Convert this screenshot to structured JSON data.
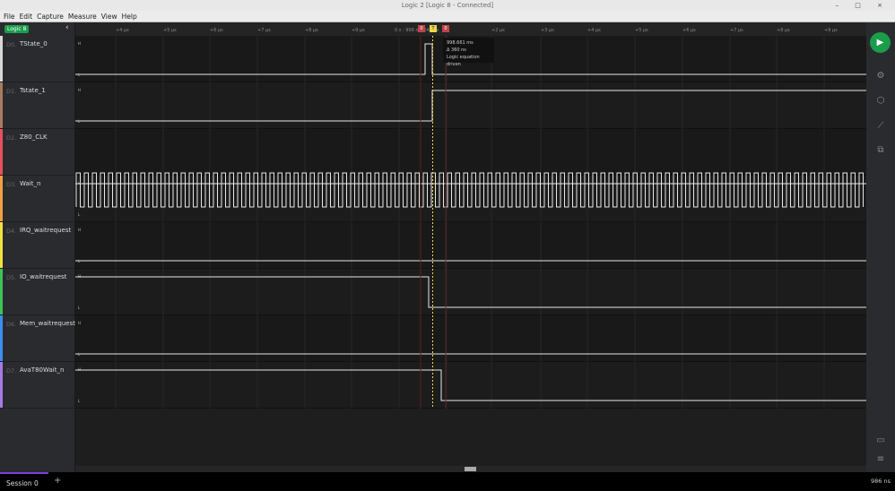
{
  "window": {
    "title": "Logic 2 [Logic 8 - Connected]",
    "controls": "– □ ×"
  },
  "menu": [
    "File",
    "Edit",
    "Capture",
    "Measure",
    "View",
    "Help"
  ],
  "device": {
    "badge": "Logic 8",
    "collapse_icon": "‹"
  },
  "channels": [
    {
      "num": "D0.",
      "name": "TState_0",
      "color": "#d8d8d8"
    },
    {
      "num": "D1.",
      "name": "Tstate_1",
      "color": "#a87b5e"
    },
    {
      "num": "D2.",
      "name": "Z80_CLK",
      "color": "#e8505e"
    },
    {
      "num": "D3.",
      "name": "Wait_n",
      "color": "#f0a040"
    },
    {
      "num": "D4.",
      "name": "IRQ_waitrequest",
      "color": "#f2e03c"
    },
    {
      "num": "D5.",
      "name": "IO_waitrequest",
      "color": "#3cc356"
    },
    {
      "num": "D6.",
      "name": "Mem_waitrequest",
      "color": "#3d8ef0"
    },
    {
      "num": "D7.",
      "name": "AvaT80Wait_n",
      "color": "#a67ae6"
    }
  ],
  "ruler": {
    "ticks_left": [
      "+4 µs",
      "+5 µs",
      "+6 µs",
      "+7 µs",
      "+8 µs",
      "+9 µs"
    ],
    "center": "0 s : 998 ms 640 µs",
    "ticks_right": [
      "+2 µs",
      "+3 µs",
      "+4 µs",
      "+5 µs",
      "+6 µs",
      "+7 µs",
      "+8 µs",
      "+9 µs"
    ]
  },
  "markers": {
    "left": "0",
    "trigger": "T",
    "right": "0"
  },
  "tooltip": {
    "time": "998.661 ms",
    "delta": "Δ 360 ns",
    "desc": "Logic equation driven"
  },
  "level_labels": {
    "high": "H",
    "low": "L"
  },
  "session": {
    "tab": "Session 0",
    "add": "+",
    "zoom": "986 ns"
  },
  "colors": {
    "accent": "#1a9d4a",
    "cursor": "#e8d84a",
    "marker": "#c0424a"
  }
}
